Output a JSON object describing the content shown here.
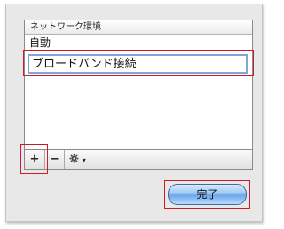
{
  "list": {
    "header": "ネットワーク環境",
    "items": [
      {
        "label": "自動"
      },
      {
        "label": "ブロードバンド接続"
      }
    ]
  },
  "toolbar": {
    "add_label": "+",
    "remove_label": "−",
    "action_icon": "gear-icon",
    "action_arrow": "▾"
  },
  "buttons": {
    "done_label": "完了"
  },
  "colors": {
    "highlight": "#cc1b2b",
    "edit_focus": "#7ea6d6"
  }
}
